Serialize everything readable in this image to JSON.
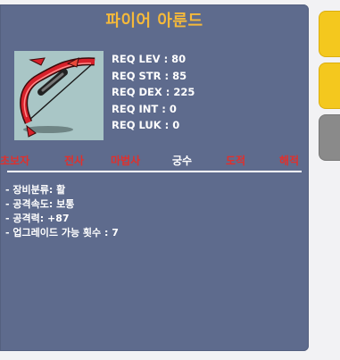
{
  "item": {
    "name": "파이어 아룬드",
    "image_icon": "bow-icon"
  },
  "requirements": [
    {
      "label": "REQ LEV : 80"
    },
    {
      "label": "REQ STR : 85"
    },
    {
      "label": "REQ DEX : 225"
    },
    {
      "label": "REQ INT : 0"
    },
    {
      "label": "REQ LUK : 0"
    }
  ],
  "jobs": [
    {
      "label": "초보자",
      "active": false
    },
    {
      "label": "전사",
      "active": false
    },
    {
      "label": "마법사",
      "active": false
    },
    {
      "label": "궁수",
      "active": true
    },
    {
      "label": "도적",
      "active": false
    },
    {
      "label": "해적",
      "active": false
    }
  ],
  "description": [
    "- 장비분류: 활",
    "- 공격속도: 보통",
    "- 공격력: +87",
    "- 업그레이드 가능 횟수 : 7"
  ],
  "colors": {
    "card_bg": "#5e6b8d",
    "title": "#f5b93a",
    "job_disabled": "#e0302d",
    "job_enabled": "#ffffff",
    "side_tab_yellow": "#f4c81e",
    "side_tab_gray": "#8a8a8a"
  }
}
